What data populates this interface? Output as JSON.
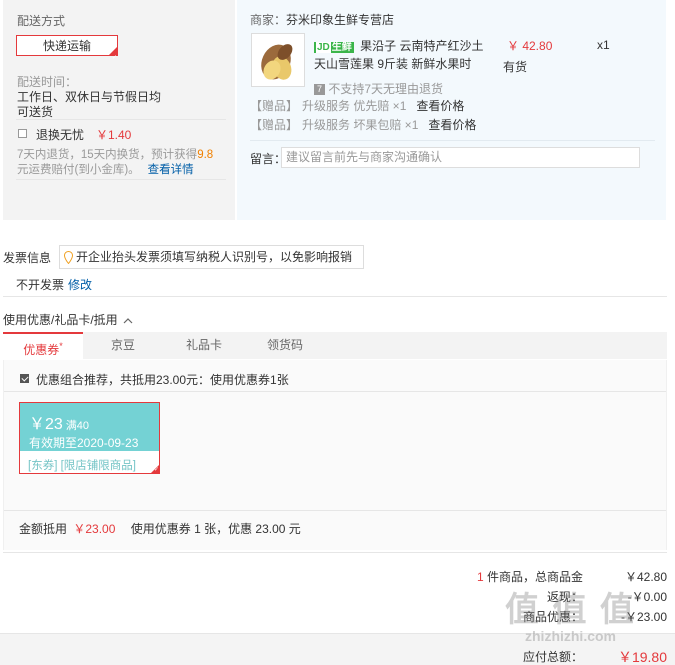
{
  "shipping": {
    "title": "配送方式",
    "method_button": "快递运输",
    "time_label": "配送时间：",
    "time_value_line1": "工作日、双休日与节假日均",
    "time_value_line2": "可送货",
    "insurance_label": "退换无忧",
    "insurance_price": "￥1.40",
    "insurance_desc_line1_prefix": "7天内退货，15天内换货，预计获得",
    "insurance_desc_highlight": "9.8",
    "insurance_desc_line2": "元运费赔付(到小金库)。",
    "insurance_link": "查看详情"
  },
  "shop": {
    "label": "商家：",
    "name": "芬米印象生鲜专营店",
    "product": {
      "tag": "生鲜",
      "tag_prefix": "JD",
      "title_line1": "果沿子 云南特产红沙土",
      "title_line2": "天山雪莲果 9斤装 新鲜水果时",
      "price": "￥ 42.80",
      "qty": "x1",
      "stock": "有货",
      "no_return_icon": "7",
      "no_return_text": "不支持7天无理由退货"
    },
    "gifts": [
      {
        "bracket": "【赠品】",
        "service": "升级服务  优先赔 ×1",
        "link": "查看价格"
      },
      {
        "bracket": "【赠品】",
        "service": "升级服务  坏果包赔 ×1",
        "link": "查看价格"
      }
    ],
    "message_label": "留言：",
    "message_placeholder": "建议留言前先与商家沟通确认"
  },
  "invoice": {
    "title": "发票信息",
    "tip": "开企业抬头发票须填写纳税人识别号，以免影响报销",
    "status": "不开发票",
    "edit": "修改"
  },
  "discount": {
    "title": "使用优惠/礼品卡/抵用",
    "tabs": [
      "优惠券",
      "京豆",
      "礼品卡",
      "领货码"
    ],
    "tab_marker": "*",
    "recommend_text": "优惠组合推荐，共抵用23.00元：使用优惠券1张",
    "coupon": {
      "amount": "￥23",
      "condition": "满40",
      "expiry": "有效期至2020-09-23",
      "scope": "[东券] [限店铺限商品]"
    },
    "summary_label": "金额抵用",
    "summary_amount": "￥23.00",
    "summary_text": "使用优惠券 1 张，优惠 23.00 元"
  },
  "totals": {
    "count_num": "1",
    "count_text": "件商品，总商品金",
    "goods_amount": "￥42.80",
    "row2_label": "返现：",
    "row2_value": "-￥0.00",
    "row3_label": "商品优惠：",
    "row3_value": "-￥23.00",
    "payable_label": "应付总额：",
    "payable_value": "￥19.80"
  },
  "watermark": {
    "main": "值 值 值",
    "sub": "zhizhizhi.com"
  }
}
